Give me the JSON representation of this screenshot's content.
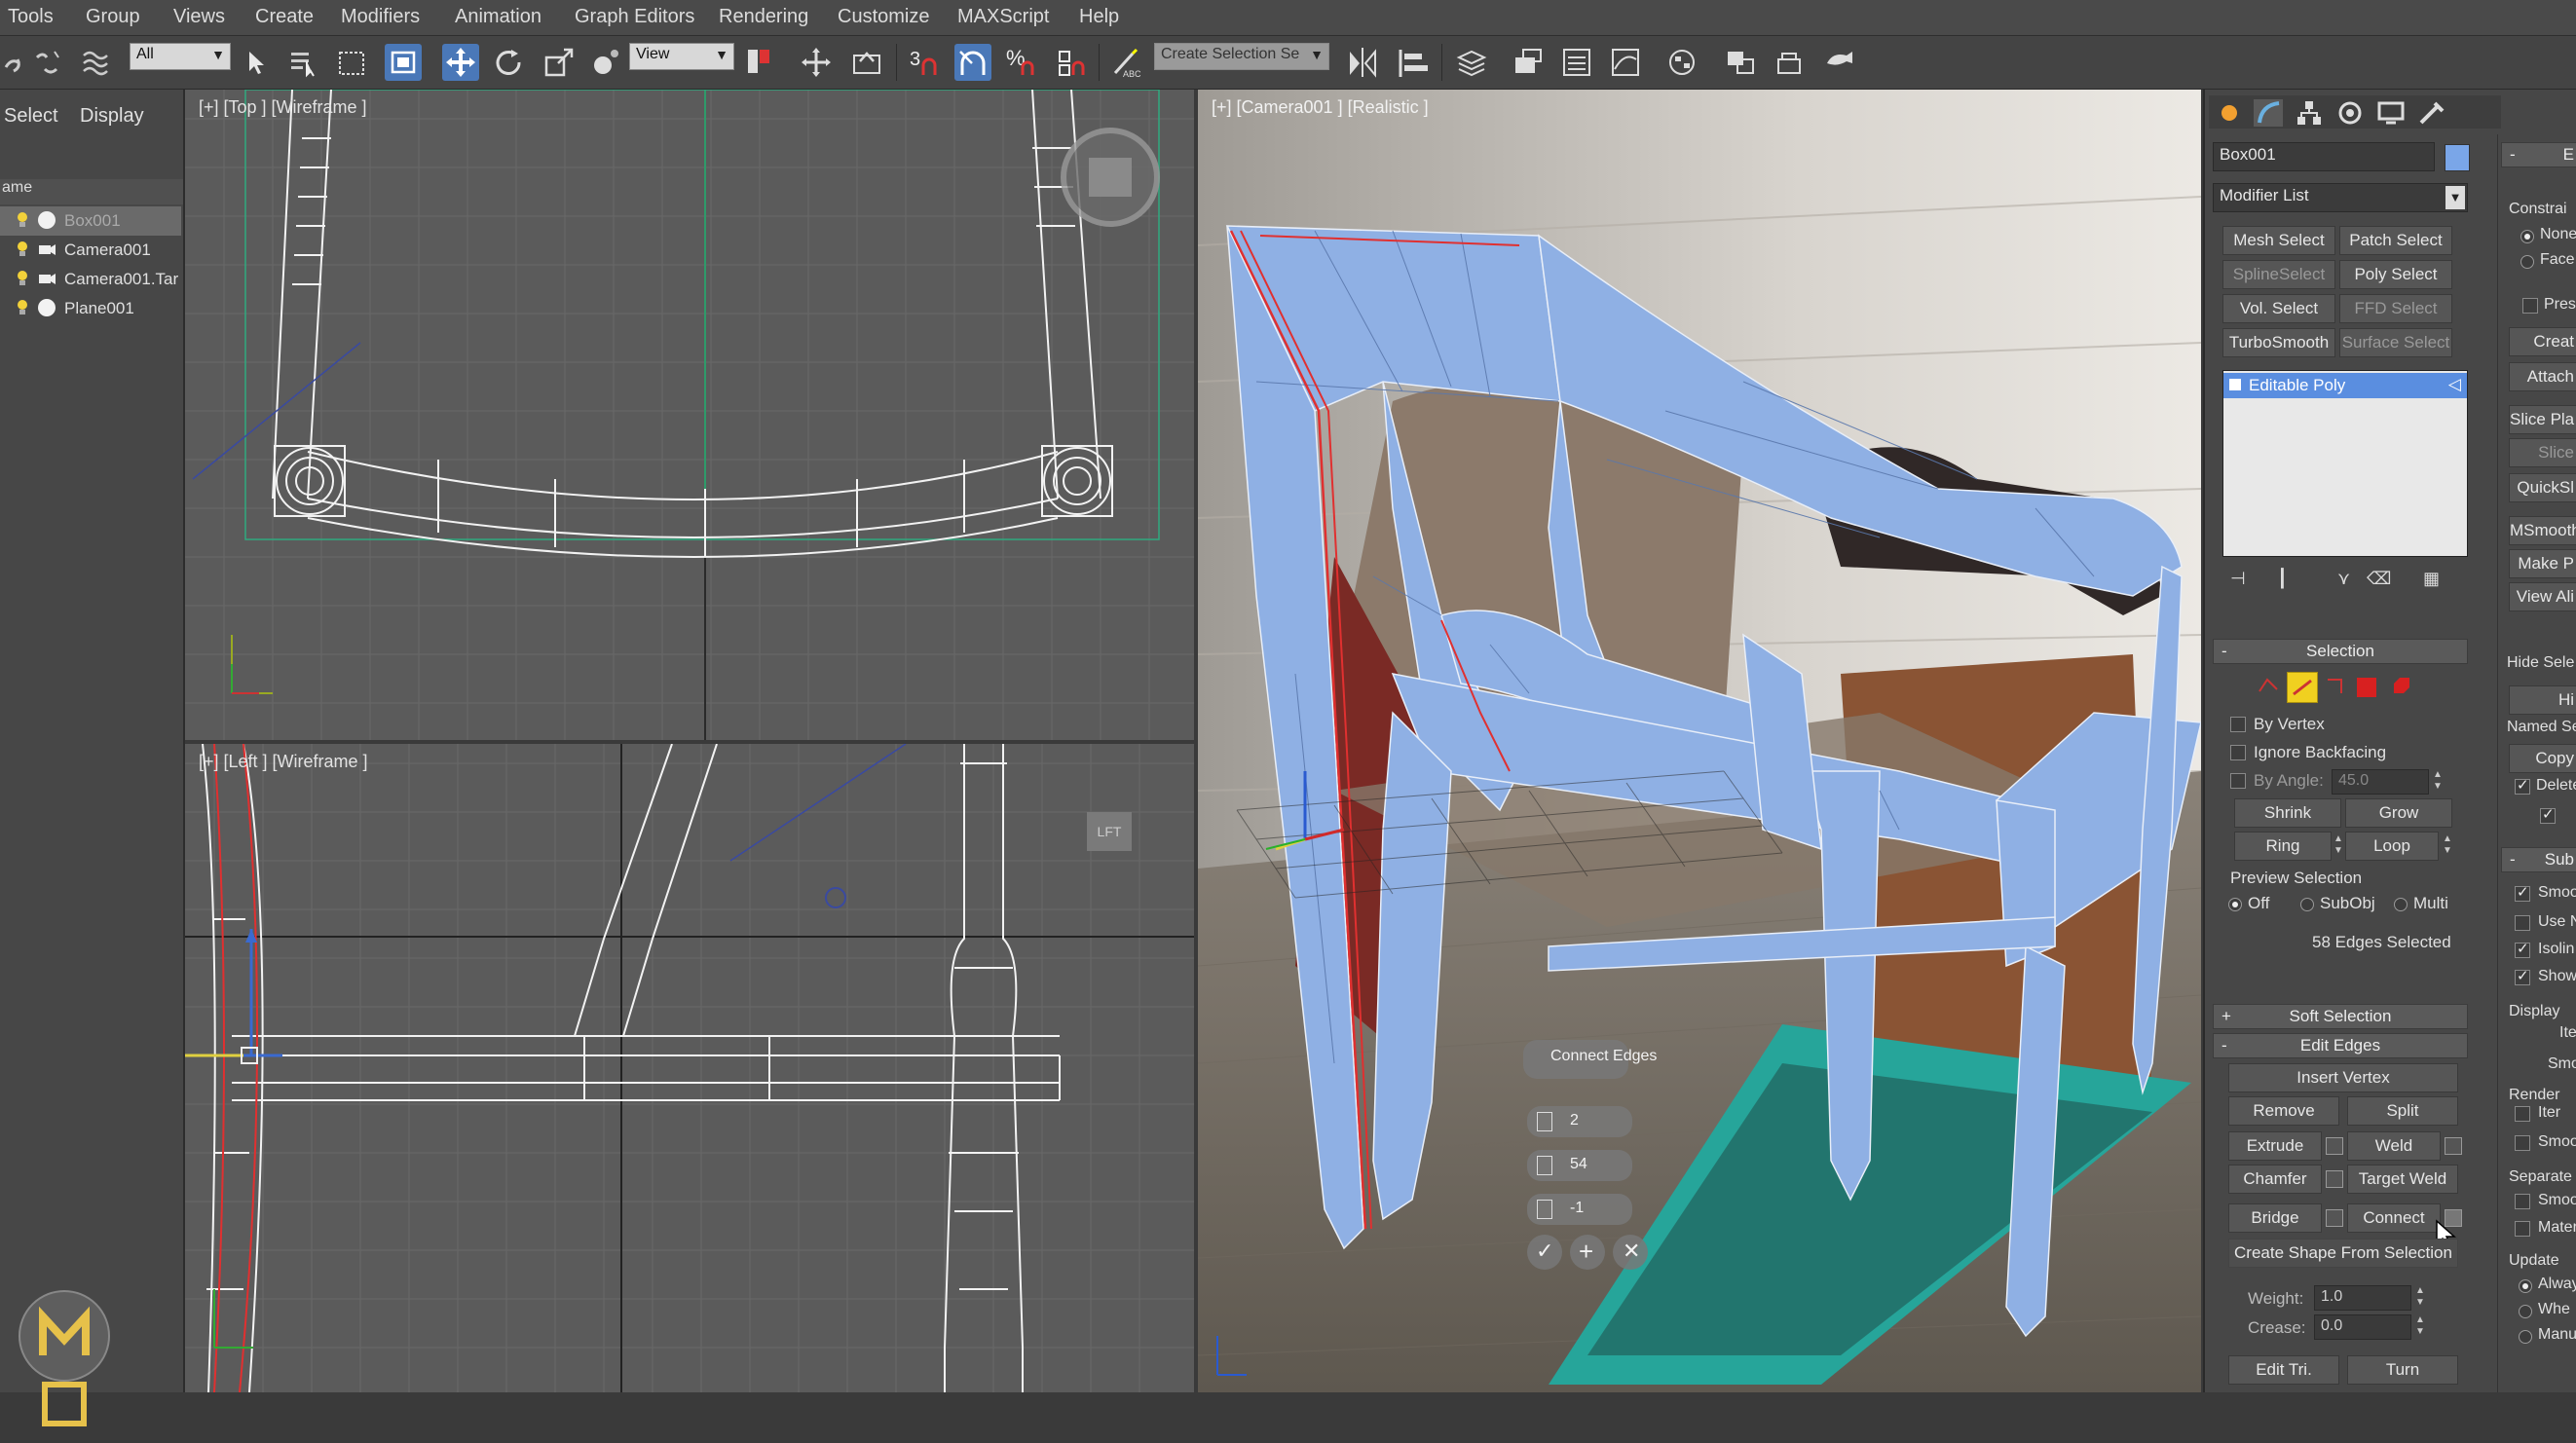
{
  "menu": [
    "Tools",
    "Group",
    "Views",
    "Create",
    "Modifiers",
    "Animation",
    "Graph Editors",
    "Rendering",
    "Customize",
    "MAXScript",
    "Help"
  ],
  "toolbar": {
    "filter_value": "All",
    "refcoord_value": "View",
    "named_selection_placeholder": "Create Selection Se",
    "snap_label": "3"
  },
  "scene": {
    "tabs": [
      "Select",
      "Display"
    ],
    "column_header": "ame",
    "objects": [
      {
        "name": "Box001",
        "selected": true,
        "icon": "geometry-icon"
      },
      {
        "name": "Camera001",
        "selected": false,
        "icon": "camera-icon"
      },
      {
        "name": "Camera001.Tar",
        "selected": false,
        "icon": "camera-target-icon"
      },
      {
        "name": "Plane001",
        "selected": false,
        "icon": "geometry-icon"
      }
    ]
  },
  "viewports": {
    "top": "[+] [Top ] [Wireframe ]",
    "left": "[+] [Left ] [Wireframe ]",
    "camera": "[+] [Camera001 ] [Realistic ]",
    "left_nav_cube": "LFT"
  },
  "caddy": {
    "title": "Connect Edges",
    "segments": "2",
    "pinch": "54",
    "slide": "-1"
  },
  "panel": {
    "object_name": "Box001",
    "object_color": "#7aa6e8",
    "modifier_list": "Modifier List",
    "modifier_buttons": [
      "Mesh Select",
      "Patch Select",
      "SplineSelect",
      "Poly Select",
      "Vol. Select",
      "FFD Select",
      "TurboSmooth",
      "Surface Select"
    ],
    "stack_item": "Editable Poly",
    "selection": {
      "title": "Selection",
      "by_vertex": "By Vertex",
      "ignore_backfacing": "Ignore Backfacing",
      "by_angle": "By Angle:",
      "angle_value": "45.0",
      "shrink": "Shrink",
      "grow": "Grow",
      "ring": "Ring",
      "loop": "Loop",
      "preview_title": "Preview Selection",
      "preview_options": [
        "Off",
        "SubObj",
        "Multi"
      ],
      "status": "58 Edges Selected"
    },
    "soft_selection": "Soft Selection",
    "edit_edges": {
      "title": "Edit Edges",
      "insert_vertex": "Insert Vertex",
      "remove": "Remove",
      "split": "Split",
      "extrude": "Extrude",
      "weld": "Weld",
      "chamfer": "Chamfer",
      "target_weld": "Target Weld",
      "bridge": "Bridge",
      "connect": "Connect",
      "create_shape": "Create Shape From Selection",
      "weight_label": "Weight:",
      "weight_value": "1.0",
      "crease_label": "Crease:",
      "crease_value": "0.0",
      "edit_tri": "Edit Tri.",
      "turn": "Turn"
    },
    "right_col": {
      "top": "E",
      "constraints": "Constrai",
      "none": "None",
      "face": "Face",
      "pres": "Pres",
      "create": "Creat",
      "attach": "Attach",
      "slice_plane": "Slice Pla",
      "slice": "Slice",
      "quickslice": "QuickSl",
      "msmooth": "MSmooth",
      "make_planar": "Make P",
      "view_align": "View Ali",
      "hide_sel": "Hide Sele",
      "hide": "Hi",
      "named_sel": "Named Se",
      "copy": "Copy",
      "delete": "Delete",
      "sub": "Sub",
      "smooth": "Smoo",
      "use_nurms": "Use N",
      "isoline": "Isolin",
      "show": "Show",
      "display": "Display",
      "iter": "Ite",
      "smooth2": "Smoo",
      "render": "Render",
      "iter2": "Iter",
      "smooth3": "Smoo",
      "separate": "Separate",
      "smooth4": "Smoo",
      "mater": "Mater",
      "update": "Update",
      "always": "Alway",
      "when": "Whe",
      "manual": "Manu"
    }
  },
  "colors": {
    "accent": "#4a78b8",
    "chair_blue": "#8fb0e4",
    "plane_teal": "#26a59a",
    "edge_select": "#e03030"
  }
}
